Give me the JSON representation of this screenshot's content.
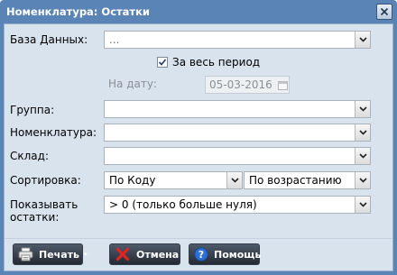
{
  "window": {
    "title": "Номенклатура: Остатки"
  },
  "fields": {
    "database": {
      "label": "База Данных:",
      "value": "..."
    },
    "whole_period": {
      "label": "За весь период",
      "checked": true
    },
    "date": {
      "label": "На дату:",
      "value": "05-03-2016"
    },
    "group": {
      "label": "Группа:",
      "value": ""
    },
    "nomenclature": {
      "label": "Номенклатура:",
      "value": ""
    },
    "warehouse": {
      "label": "Склад:",
      "value": ""
    },
    "sort": {
      "label": "Сортировка:",
      "field_value": "По Коду",
      "order_value": "По возрастанию"
    },
    "show": {
      "label_line1": "Показывать",
      "label_line2": "остатки:",
      "value": "> 0 (только больше нуля)"
    }
  },
  "buttons": {
    "print": "Печать",
    "cancel": "Отмена",
    "help": "Помощь"
  },
  "colors": {
    "title_bar": "#5a84b5",
    "body_bg": "#d9e3ee",
    "button_bg": "#2e3540"
  },
  "icons": {
    "print": "printer-icon",
    "cancel": "red-x-icon",
    "help": "question-icon",
    "close": "close-icon",
    "dropdown": "chevron-down-icon",
    "calendar": "calendar-icon"
  }
}
